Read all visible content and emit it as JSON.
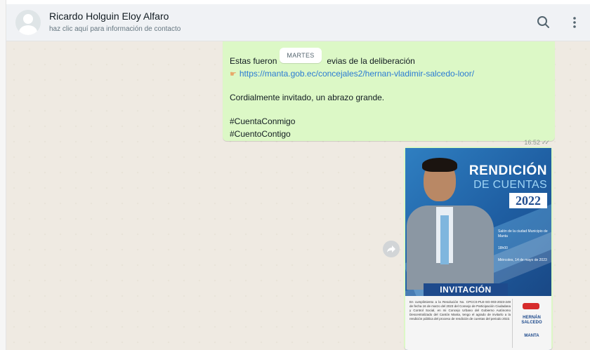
{
  "header": {
    "contact_name": "Ricardo Holguin Eloy Alfaro",
    "contact_sub": "haz clic aquí para información de contacto"
  },
  "date_pill": "MARTES",
  "message": {
    "line1_prefix": "Estas fueron",
    "line1_suffix": "evias de la deliberación",
    "link": "https://manta.gob.ec/concejales2/hernan-vladimir-salcedo-loor/",
    "line3": "Cordialmente invitado, un abrazo grande.",
    "hashtag1": "#CuentaConmigo",
    "hashtag2": "#CuentoContigo",
    "time": "16:52"
  },
  "flyer": {
    "title": "RENDICIÓN",
    "subtitle": "DE CUENTAS",
    "year": "2022",
    "detail_place": "Salón de la ciudad Municipio de Manta",
    "detail_time": "18h00",
    "detail_date": "Miércoles, 14 de mayo de 2023",
    "banner": "INVITACIÓN",
    "card_text": "En cumplimiento a la Resolución No. CPCCS-PLE-SG-003-2023-249 de fecha 16 de marzo del 2023 del Consejo de Participación Ciudadana y Control Social, en mi Concejo Urbano del Gobierno Autónomo Descentralizado del Cantón Manta, tengo el agrado de invitarlo a la rendición pública del proceso de rendición de cuentas del periodo 2022.",
    "logo_b": "HERNÁN SALCEDO",
    "logo_c": "MANTA"
  },
  "colors": {
    "header_bg": "#f0f2f5",
    "chat_bg": "#efeae2",
    "outgoing_bubble": "#dcf8c6",
    "link": "#2a7bd3"
  },
  "icons": [
    "avatar-icon",
    "search-icon",
    "menu-icon",
    "forward-icon",
    "double-check-icon"
  ]
}
